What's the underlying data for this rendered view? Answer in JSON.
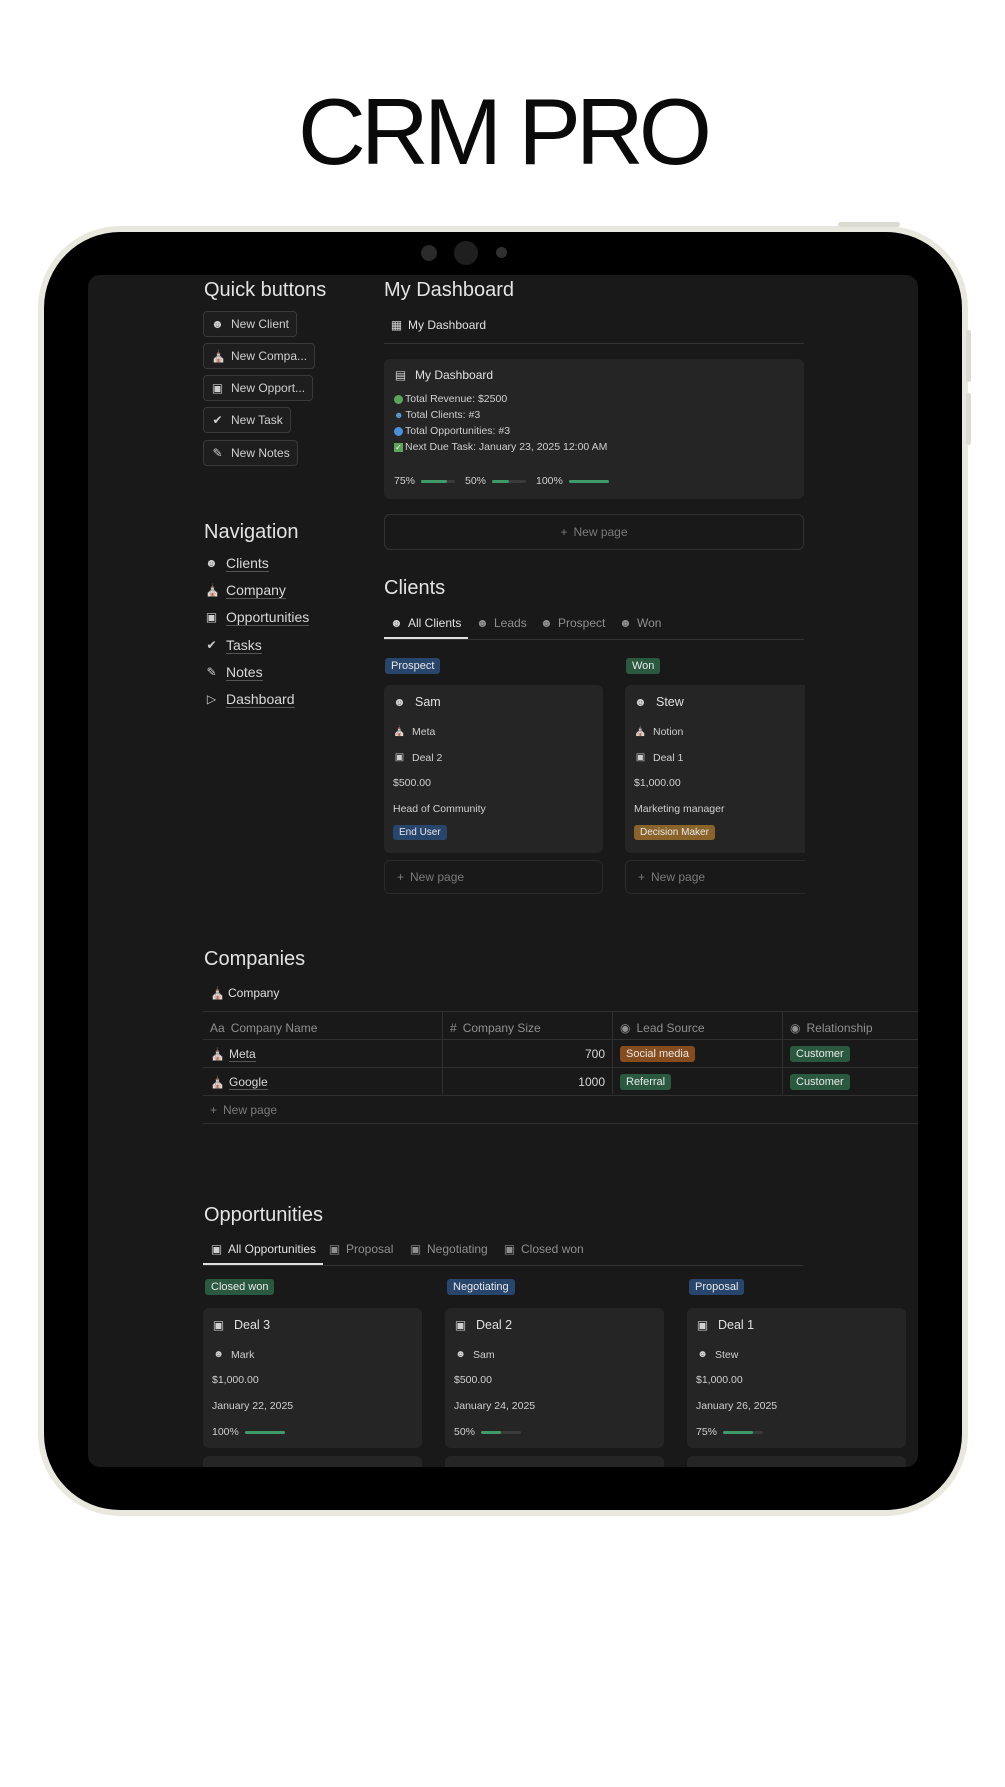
{
  "hero": {
    "title": "CRM PRO"
  },
  "quick_buttons": {
    "heading": "Quick buttons",
    "items": [
      {
        "label": "New Client",
        "icon": "users-icon"
      },
      {
        "label": "New Compa...",
        "icon": "bank-icon"
      },
      {
        "label": "New Opport...",
        "icon": "briefcase-icon"
      },
      {
        "label": "New Task",
        "icon": "check-circle-icon"
      },
      {
        "label": "New Notes",
        "icon": "edit-icon"
      }
    ]
  },
  "navigation": {
    "heading": "Navigation",
    "items": [
      {
        "label": "Clients",
        "icon": "users-icon"
      },
      {
        "label": "Company",
        "icon": "bank-icon"
      },
      {
        "label": "Opportunities",
        "icon": "briefcase-icon"
      },
      {
        "label": "Tasks",
        "icon": "check-circle-icon"
      },
      {
        "label": "Notes",
        "icon": "edit-icon"
      },
      {
        "label": "Dashboard",
        "icon": "terminal-icon"
      }
    ]
  },
  "dashboard": {
    "heading": "My Dashboard",
    "view_label": "My Dashboard",
    "card": {
      "title": "My Dashboard",
      "lines": [
        "Total Revenue: $2500",
        "Total Clients: #3",
        "Total Opportunities: #3",
        "Next Due Task: January 23, 2025 12:00 AM"
      ],
      "progress": [
        {
          "label": "75%",
          "value": 0.75
        },
        {
          "label": "50%",
          "value": 0.5
        },
        {
          "label": "100%",
          "value": 1.0
        }
      ]
    },
    "new_page": "New page"
  },
  "clients": {
    "heading": "Clients",
    "tabs": [
      "All Clients",
      "Leads",
      "Prospect",
      "Won"
    ],
    "columns": [
      {
        "group": "Prospect",
        "card": {
          "name": "Sam",
          "company": "Meta",
          "deal": "Deal 2",
          "amount": "$500.00",
          "role": "Head of Community",
          "tag": "End User"
        },
        "new_page": "New page"
      },
      {
        "group": "Won",
        "card": {
          "name": "Stew",
          "company": "Notion",
          "deal": "Deal 1",
          "amount": "$1,000.00",
          "role": "Marketing manager",
          "tag": "Decision Maker"
        },
        "new_page": "New page"
      }
    ]
  },
  "companies": {
    "heading": "Companies",
    "view_label": "Company",
    "headers": [
      "Company Name",
      "Company Size",
      "Lead Source",
      "Relationship"
    ],
    "header_prefix": "Aa",
    "rows": [
      {
        "name": "Meta",
        "size": "700",
        "source": "Social media",
        "relationship": "Customer"
      },
      {
        "name": "Google",
        "size": "1000",
        "source": "Referral",
        "relationship": "Customer"
      }
    ],
    "new_page": "New page"
  },
  "opportunities": {
    "heading": "Opportunities",
    "tabs": [
      "All Opportunities",
      "Proposal",
      "Negotiating",
      "Closed won"
    ],
    "columns": [
      {
        "group": "Closed won",
        "card": {
          "name": "Deal 3",
          "contact": "Mark",
          "amount": "$1,000.00",
          "date": "January 22, 2025",
          "progress_label": "100%",
          "progress": 1.0
        }
      },
      {
        "group": "Negotiating",
        "card": {
          "name": "Deal 2",
          "contact": "Sam",
          "amount": "$500.00",
          "date": "January 24, 2025",
          "progress_label": "50%",
          "progress": 0.5
        }
      },
      {
        "group": "Proposal",
        "card": {
          "name": "Deal 1",
          "contact": "Stew",
          "amount": "$1,000.00",
          "date": "January 26, 2025",
          "progress_label": "75%",
          "progress": 0.75
        }
      }
    ]
  },
  "colors": {
    "screen_bg": "#191919",
    "card_bg": "#252525",
    "accent_green": "#3f9b6a",
    "tag_blue": "#28456c",
    "tag_green": "#2b593f",
    "tag_orange": "#854c1d"
  }
}
